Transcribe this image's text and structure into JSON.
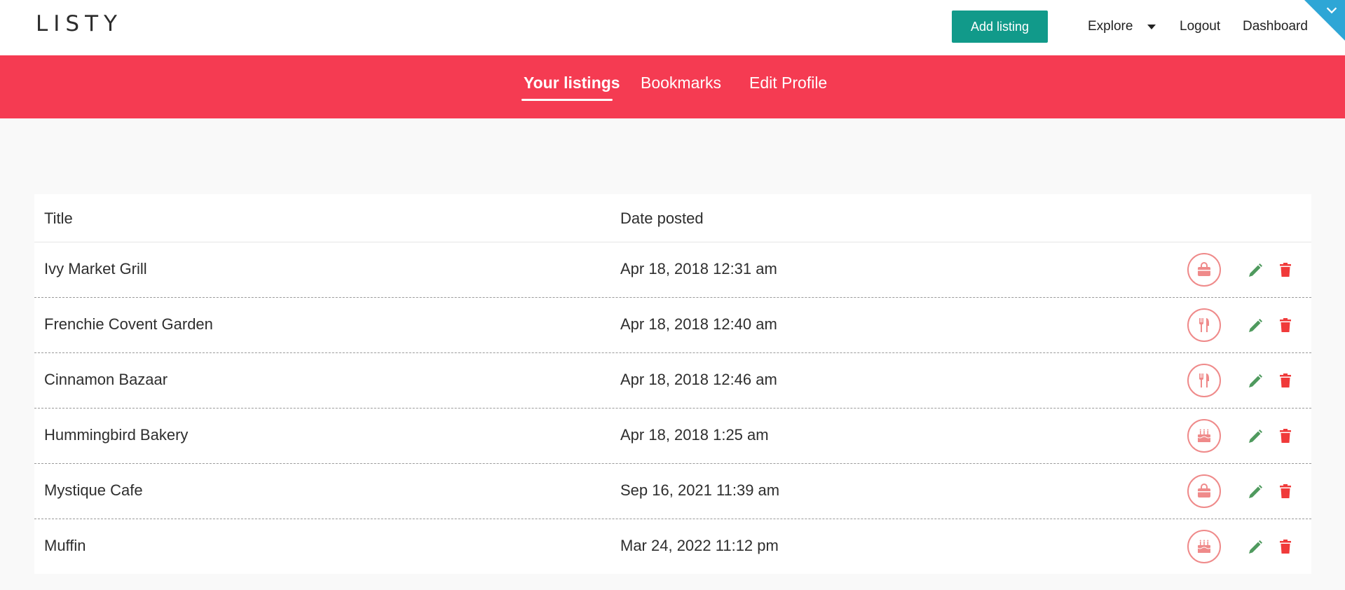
{
  "header": {
    "logo": "LISTY",
    "add_listing": "Add listing",
    "nav": {
      "explore": "Explore",
      "logout": "Logout",
      "dashboard": "Dashboard"
    }
  },
  "tabs": [
    {
      "label": "Your listings",
      "active": true
    },
    {
      "label": "Bookmarks",
      "active": false
    },
    {
      "label": "Edit Profile",
      "active": false
    }
  ],
  "table": {
    "columns": [
      "Title",
      "Date posted"
    ],
    "rows": [
      {
        "title": "Ivy Market Grill",
        "date": "Apr 18, 2018 12:31 am",
        "category_icon": "shopping-bag-icon"
      },
      {
        "title": "Frenchie Covent Garden",
        "date": "Apr 18, 2018 12:40 am",
        "category_icon": "fork-knife-icon"
      },
      {
        "title": "Cinnamon Bazaar",
        "date": "Apr 18, 2018 12:46 am",
        "category_icon": "fork-knife-icon"
      },
      {
        "title": "Hummingbird Bakery",
        "date": "Apr 18, 2018 1:25 am",
        "category_icon": "birthday-cake-icon"
      },
      {
        "title": "Mystique Cafe",
        "date": "Sep 16, 2021 11:39 am",
        "category_icon": "shopping-bag-icon"
      },
      {
        "title": "Muffin",
        "date": "Mar 24, 2022 11:12 pm",
        "category_icon": "birthday-cake-icon"
      }
    ]
  },
  "colors": {
    "accent_red": "#f53b52",
    "button_teal": "#119a8a",
    "corner_blue": "#2ea6d6",
    "edit_green": "#4f9a5e",
    "delete_red": "#f03a3a",
    "category_icon": "#ef8a8a"
  }
}
